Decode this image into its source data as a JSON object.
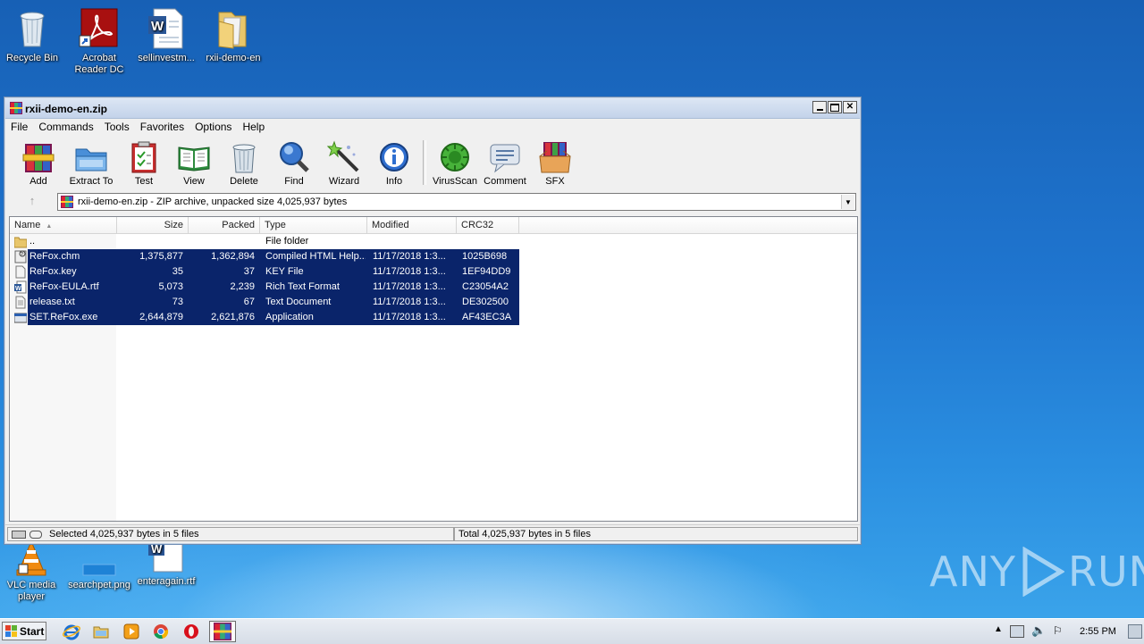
{
  "desktop": {
    "icons": [
      {
        "label": "Recycle Bin"
      },
      {
        "label": "Acrobat Reader DC"
      },
      {
        "label": "sellinvestm..."
      },
      {
        "label": "rxii-demo-en"
      },
      {
        "label": "VLC media player"
      },
      {
        "label": "searchpet.png"
      },
      {
        "label": "enteragain.rtf"
      }
    ],
    "watermark": {
      "left": "ANY",
      "right": "RUN"
    }
  },
  "window": {
    "title": "rxii-demo-en.zip",
    "menu": [
      "File",
      "Commands",
      "Tools",
      "Favorites",
      "Options",
      "Help"
    ],
    "toolbar": [
      {
        "label": "Add",
        "icon": "add-archive-icon"
      },
      {
        "label": "Extract To",
        "icon": "extract-folder-icon"
      },
      {
        "label": "Test",
        "icon": "test-clipboard-icon"
      },
      {
        "label": "View",
        "icon": "view-book-icon"
      },
      {
        "label": "Delete",
        "icon": "trash-icon"
      },
      {
        "label": "Find",
        "icon": "magnifier-icon"
      },
      {
        "label": "Wizard",
        "icon": "magic-wand-icon"
      },
      {
        "label": "Info",
        "icon": "info-icon"
      },
      {
        "label": "VirusScan",
        "icon": "virus-scan-icon"
      },
      {
        "label": "Comment",
        "icon": "comment-icon"
      },
      {
        "label": "SFX",
        "icon": "sfx-box-icon"
      }
    ],
    "address": "rxii-demo-en.zip - ZIP archive, unpacked size 4,025,937 bytes",
    "columns": [
      "Name",
      "Size",
      "Packed",
      "Type",
      "Modified",
      "CRC32"
    ],
    "rows": [
      {
        "name": "..",
        "size": "",
        "packed": "",
        "type": "File folder",
        "modified": "",
        "crc": "",
        "icon": "folder-icon",
        "selected": false
      },
      {
        "name": "ReFox.chm",
        "size": "1,375,877",
        "packed": "1,362,894",
        "type": "Compiled HTML Help...",
        "modified": "11/17/2018 1:3...",
        "crc": "1025B698",
        "icon": "chm-file-icon",
        "selected": true
      },
      {
        "name": "ReFox.key",
        "size": "35",
        "packed": "37",
        "type": "KEY File",
        "modified": "11/17/2018 1:3...",
        "crc": "1EF94DD9",
        "icon": "blank-file-icon",
        "selected": true
      },
      {
        "name": "ReFox-EULA.rtf",
        "size": "5,073",
        "packed": "2,239",
        "type": "Rich Text Format",
        "modified": "11/17/2018 1:3...",
        "crc": "C23054A2",
        "icon": "word-file-icon",
        "selected": true
      },
      {
        "name": "release.txt",
        "size": "73",
        "packed": "67",
        "type": "Text Document",
        "modified": "11/17/2018 1:3...",
        "crc": "DE302500",
        "icon": "text-file-icon",
        "selected": true
      },
      {
        "name": "SET.ReFox.exe",
        "size": "2,644,879",
        "packed": "2,621,876",
        "type": "Application",
        "modified": "11/17/2018 1:3...",
        "crc": "AF43EC3A",
        "icon": "exe-file-icon",
        "selected": true
      }
    ],
    "status_left": "Selected 4,025,937 bytes in 5 files",
    "status_right": "Total 4,025,937 bytes in 5 files"
  },
  "taskbar": {
    "start": "Start",
    "clock": "2:55 PM"
  }
}
